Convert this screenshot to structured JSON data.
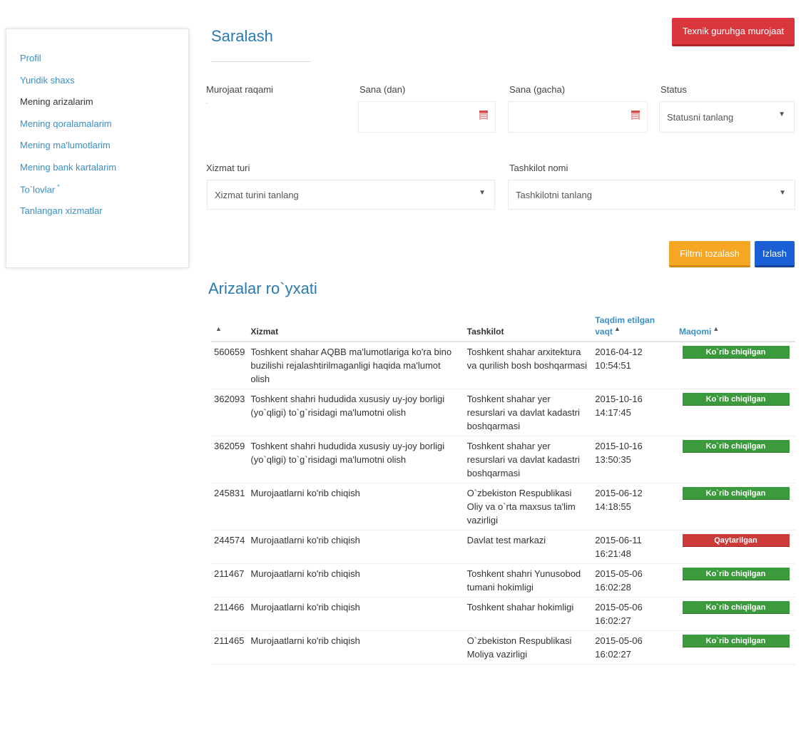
{
  "sidebar": {
    "items": [
      {
        "label": "Profil",
        "active": false
      },
      {
        "label": "Yuridik shaxs",
        "active": false
      },
      {
        "label": "Mening arizalarim",
        "active": true
      },
      {
        "label": "Mening qoralamalarim",
        "active": false
      },
      {
        "label": "Mening ma'lumotlarim",
        "active": false
      },
      {
        "label": "Mening bank kartalarim",
        "active": false
      },
      {
        "label": "To`lovlar",
        "active": false,
        "mark": "*"
      },
      {
        "label": "Tanlangan xizmatlar",
        "active": false
      }
    ]
  },
  "header": {
    "title": "Saralash",
    "support_button": "Texnik guruhga murojaat"
  },
  "filters": {
    "request_number_label": "Murojaat raqami",
    "request_number_value": "",
    "date_from_label": "Sana (dan)",
    "date_from_value": "",
    "date_to_label": "Sana (gacha)",
    "date_to_value": "",
    "status_label": "Status",
    "status_value": "Statusni tanlang",
    "service_type_label": "Xizmat turi",
    "service_type_value": "Xizmat turini tanlang",
    "organization_label": "Tashkilot nomi",
    "organization_value": "Tashkilotni tanlang",
    "clear_button": "Filtrni tozalash",
    "search_button": "Izlash"
  },
  "list": {
    "title": "Arizalar ro`yxati",
    "columns": {
      "id": "",
      "service": "Xizmat",
      "organization": "Tashkilot",
      "submitted": "Taqdim etilgan vaqt",
      "status": "Maqomi"
    },
    "rows": [
      {
        "id": "560659",
        "service": "Toshkent shahar AQBB ma'lumotlariga ko'ra bino buzilishi rejalashtirilmaganligi haqida ma'lumot olish",
        "organization": "Toshkent shahar arxitektura va qurilish bosh boshqarmasi",
        "date": "2016-04-12",
        "time": "10:54:51",
        "status": "Ko`rib chiqilgan",
        "status_type": "green"
      },
      {
        "id": "362093",
        "service": "Toshkent shahri hududida xususiy uy-joy borligi (yo`qligi) to`g`risidagi ma'lumotni olish",
        "organization": "Toshkent shahar yer resurslari va davlat kadastri boshqarmasi",
        "date": "2015-10-16",
        "time": "14:17:45",
        "status": "Ko`rib chiqilgan",
        "status_type": "green"
      },
      {
        "id": "362059",
        "service": "Toshkent shahri hududida xususiy uy-joy borligi (yo`qligi) to`g`risidagi ma'lumotni olish",
        "organization": "Toshkent shahar yer resurslari va davlat kadastri boshqarmasi",
        "date": "2015-10-16",
        "time": "13:50:35",
        "status": "Ko`rib chiqilgan",
        "status_type": "green"
      },
      {
        "id": "245831",
        "service": "Murojaatlarni ko'rib chiqish",
        "organization": "O`zbekiston Respublikasi Oliy va o`rta maxsus ta'lim vazirligi",
        "date": "2015-06-12",
        "time": "14:18:55",
        "status": "Ko`rib chiqilgan",
        "status_type": "green"
      },
      {
        "id": "244574",
        "service": "Murojaatlarni ko'rib chiqish",
        "organization": "Davlat test markazi",
        "date": "2015-06-11",
        "time": "16:21:48",
        "status": "Qaytarilgan",
        "status_type": "red"
      },
      {
        "id": "211467",
        "service": "Murojaatlarni ko'rib chiqish",
        "organization": "Toshkent shahri Yunusobod tumani hokimligi",
        "date": "2015-05-06",
        "time": "16:02:28",
        "status": "Ko`rib chiqilgan",
        "status_type": "green"
      },
      {
        "id": "211466",
        "service": "Murojaatlarni ko'rib chiqish",
        "organization": "Toshkent shahar hokimligi",
        "date": "2015-05-06",
        "time": "16:02:27",
        "status": "Ko`rib chiqilgan",
        "status_type": "green"
      },
      {
        "id": "211465",
        "service": "Murojaatlarni ko'rib chiqish",
        "organization": "O`zbekiston Respublikasi Moliya vazirligi",
        "date": "2015-05-06",
        "time": "16:02:27",
        "status": "Ko`rib chiqilgan",
        "status_type": "green"
      }
    ]
  },
  "colors": {
    "accent": "#2a7ab0",
    "link": "#3a8fc4",
    "danger": "#d9363e",
    "warning": "#f5a623",
    "primary": "#1b5fd6",
    "success": "#3b9a3b"
  }
}
